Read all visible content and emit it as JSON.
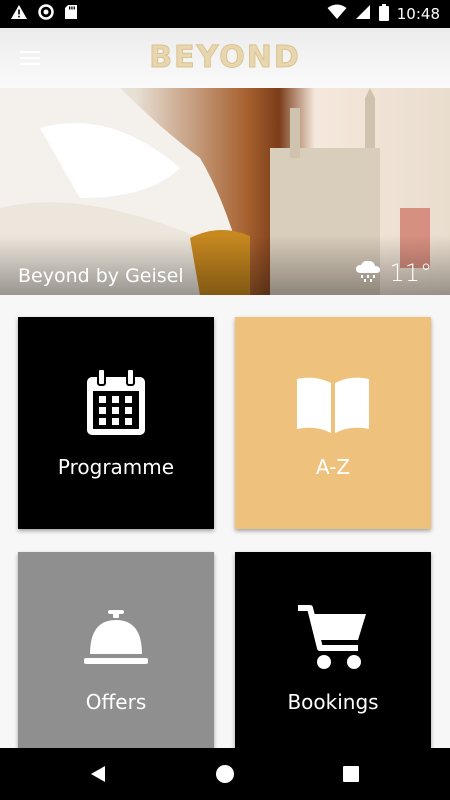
{
  "status_bar": {
    "time": "10:48",
    "left_icons": [
      "warning-icon",
      "sync-icon",
      "sd-card-icon"
    ],
    "right_icons": [
      "wifi-icon",
      "signal-icon",
      "battery-icon"
    ]
  },
  "app_bar": {
    "logo_text": "BEYOND",
    "menu_icon": "hamburger-menu-icon"
  },
  "hero": {
    "title": "Beyond by Geisel",
    "weather": {
      "icon": "rain-cloud-icon",
      "temperature": "11°"
    }
  },
  "tiles": [
    {
      "label": "Programme",
      "icon": "calendar-icon",
      "background": "#000000"
    },
    {
      "label": "A-Z",
      "icon": "book-icon",
      "background": "#eec27c"
    },
    {
      "label": "Offers",
      "icon": "service-bell-icon",
      "background": "#8f8f8f"
    },
    {
      "label": "Bookings",
      "icon": "shopping-cart-icon",
      "background": "#000000"
    }
  ],
  "nav_bar": {
    "buttons": [
      "back-icon",
      "home-icon",
      "recent-apps-icon"
    ]
  }
}
